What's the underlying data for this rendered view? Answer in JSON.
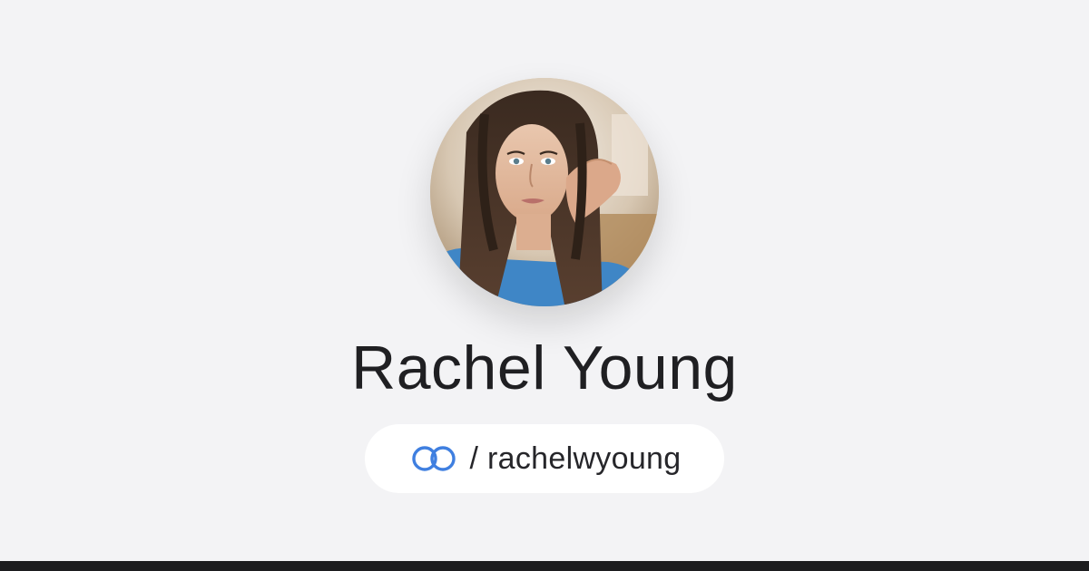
{
  "profile": {
    "name": "Rachel Young",
    "handle_separator": "/",
    "handle": "rachelwyoung"
  },
  "icons": {
    "brand": "linked-rings-icon",
    "avatar": "profile-photo"
  },
  "colors": {
    "background": "#f3f3f5",
    "brand_blue": "#3f7fe0",
    "name_text": "#1f1f22",
    "pill_background": "#ffffff",
    "bottom_bar": "#1d1d1f"
  }
}
